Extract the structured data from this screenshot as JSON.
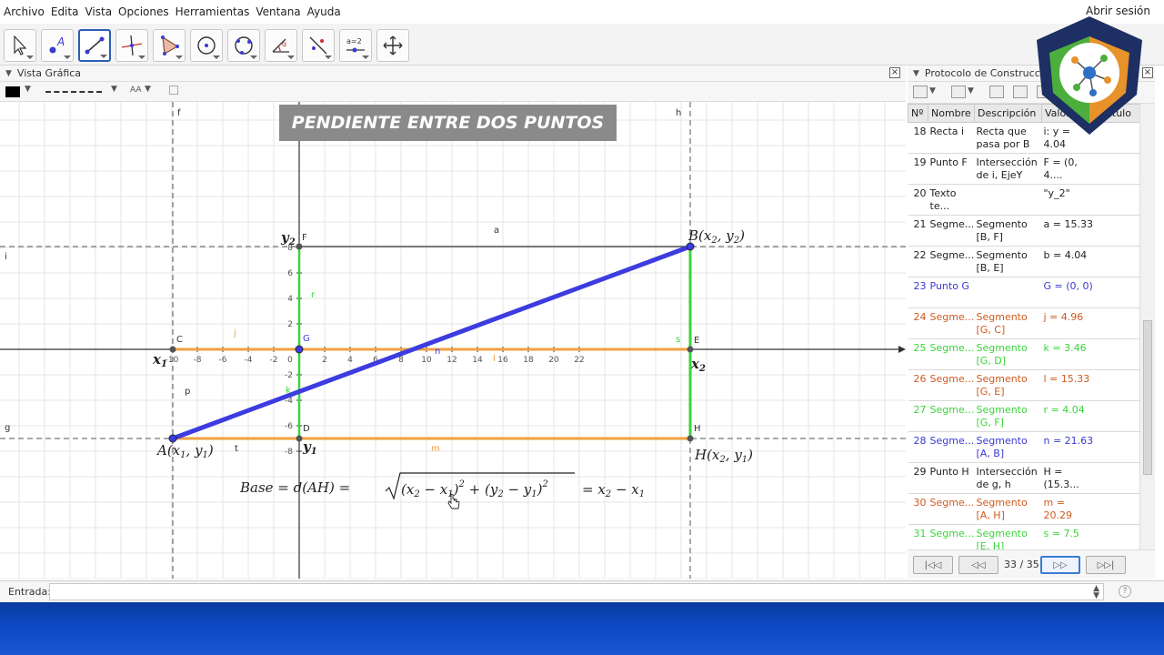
{
  "menu": [
    "Archivo",
    "Edita",
    "Vista",
    "Opciones",
    "Herramientas",
    "Ventana",
    "Ayuda"
  ],
  "signin": "Abrir sesión",
  "toolbar": {
    "tools": [
      "move-tool",
      "point-tool",
      "segment-tool",
      "perpendicular-line-tool",
      "polygon-tool",
      "circle-tool",
      "ellipse-tool",
      "angle-tool",
      "reflect-tool",
      "slider-tool",
      "move-view-tool"
    ],
    "slider_label": "a=2",
    "active_tool": "segment-tool"
  },
  "graphics_view": {
    "title": "Vista Gráfica",
    "banner": "PENDIENTE ENTRE DOS PUNTOS",
    "style_bar": {
      "font_size_label": "AA"
    },
    "x_ticks": [
      "-10",
      "-8",
      "-6",
      "-4",
      "-2",
      "0",
      "2",
      "4",
      "6",
      "8",
      "10",
      "12",
      "14",
      "16",
      "18",
      "20",
      "22"
    ],
    "y_ticks": [
      "8",
      "6",
      "4",
      "2",
      "-2",
      "-4",
      "-6",
      "-8"
    ],
    "labels": {
      "f": "f",
      "h": "h",
      "i": "i",
      "g": "g",
      "a": "a",
      "C": "C",
      "D": "D",
      "E": "E",
      "F": "F",
      "G": "G",
      "H": "H",
      "j": "j",
      "n": "n",
      "l": "l",
      "s": "s",
      "r": "r",
      "k": "k",
      "p": "p",
      "t": "t",
      "m": "m"
    },
    "formula_parts": {
      "lhs": "Base = d(AH) =",
      "rad_1": "(x",
      "sub_2": "2",
      "minus_1": " − x",
      "sub_1": "1",
      "close_1": ")",
      "sq_1": "2",
      "plus": " + (y",
      "minus_2": " − y",
      "sub_1b": "1",
      "close_2": ")",
      "sq_2": "2",
      "rhs": "= x",
      "rhs_sub2": "2",
      "rhs_minus": " − x",
      "rhs_sub1": "1"
    },
    "annotations": {
      "y2_main": "y",
      "y2_sub": "2",
      "x1_main": "x",
      "x1_sub": "1",
      "x2_main": "x",
      "x2_sub": "2",
      "y1_main": "y",
      "y1_sub": "1",
      "A_label": "A(x",
      "A_sub1": "1",
      "A_mid": ", y",
      "A_sub2": "1",
      "A_end": ")",
      "B_label": "B(x",
      "B_sub1": "2",
      "B_mid": ", y",
      "B_sub2": "2",
      "B_end": ")",
      "H_label": "H(x",
      "H_sub1": "2",
      "H_mid": ", y",
      "H_sub2": "1",
      "H_end": ")"
    },
    "colors": {
      "blue": "#3c3ce0",
      "green": "#3ad53a",
      "orange": "#f0a142",
      "axis": "#333333",
      "grid": "#e2e2e2"
    }
  },
  "protocol": {
    "title": "Protocolo de Construcción",
    "headers": [
      "Nº",
      "Nombre",
      "Descripción",
      "Valor",
      "Rótulo"
    ],
    "rows": [
      {
        "n": "18",
        "name": "Recta i",
        "desc": "Recta que pasa por B",
        "value": "i: y = 4.04",
        "color": "#222222"
      },
      {
        "n": "19",
        "name": "Punto F",
        "desc": "Intersección de i, EjeY",
        "value": "F = (0, 4....",
        "color": "#222222"
      },
      {
        "n": "20",
        "name": "Texto te...",
        "desc": "",
        "value": "\"y_2\"",
        "color": "#222222"
      },
      {
        "n": "21",
        "name": "Segme...",
        "desc": "Segmento [B, F]",
        "value": "a = 15.33",
        "color": "#222222"
      },
      {
        "n": "22",
        "name": "Segme...",
        "desc": "Segmento [B, E]",
        "value": "b = 4.04",
        "color": "#222222"
      },
      {
        "n": "23",
        "name": "Punto G",
        "desc": "",
        "value": "G = (0, 0)",
        "color": "#3a3ad0"
      },
      {
        "n": "24",
        "name": "Segme...",
        "desc": "Segmento [G, C]",
        "value": "j = 4.96",
        "color": "#d05a1e"
      },
      {
        "n": "25",
        "name": "Segme...",
        "desc": "Segmento [G, D]",
        "value": "k = 3.46",
        "color": "#3ad53a"
      },
      {
        "n": "26",
        "name": "Segme...",
        "desc": "Segmento [G, E]",
        "value": "l = 15.33",
        "color": "#d05a1e"
      },
      {
        "n": "27",
        "name": "Segme...",
        "desc": "Segmento [G, F]",
        "value": "r = 4.04",
        "color": "#3ad53a"
      },
      {
        "n": "28",
        "name": "Segme...",
        "desc": "Segmento [A, B]",
        "value": "n = 21.63",
        "color": "#3a3ad0"
      },
      {
        "n": "29",
        "name": "Punto H",
        "desc": "Intersección de g, h",
        "value": "H = (15.3...",
        "color": "#222222"
      },
      {
        "n": "30",
        "name": "Segme...",
        "desc": "Segmento [A, H]",
        "value": "m = 20.29",
        "color": "#d05a1e"
      },
      {
        "n": "31",
        "name": "Segme...",
        "desc": "Segmento [E, H]",
        "value": "s = 7.5",
        "color": "#3ad53a"
      }
    ],
    "nav_count": "33 / 35"
  },
  "input_bar": {
    "label": "Entrada:",
    "value": "",
    "help": "?"
  }
}
